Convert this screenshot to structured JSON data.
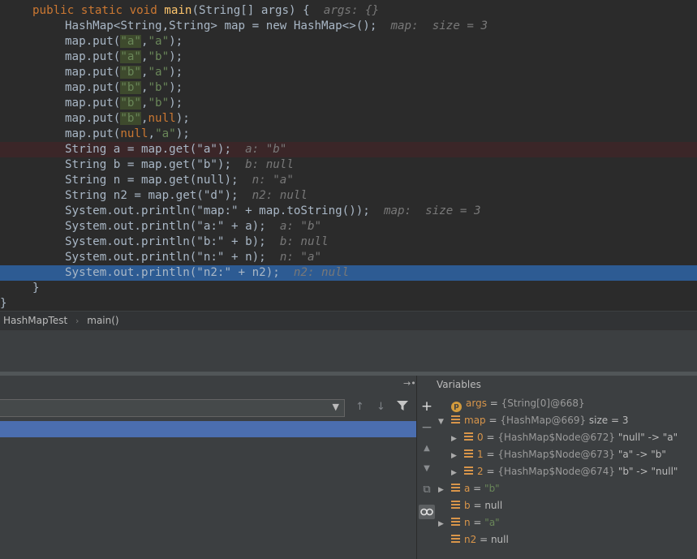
{
  "editor": {
    "method_sig": {
      "pre": "public static void ",
      "name": "main",
      "params": "(String[] args) ",
      "brace": "{",
      "hint": "args: {}"
    },
    "lines": [
      {
        "code": "HashMap<String,String> map = new HashMap<>();",
        "hint": "map:  size = 3"
      },
      {
        "call": "map.put(",
        "a1": "\"a\"",
        "a2": "\"a\""
      },
      {
        "call": "map.put(",
        "a1": "\"a\"",
        "a2": "\"b\""
      },
      {
        "call": "map.put(",
        "a1": "\"b\"",
        "a2": "\"a\""
      },
      {
        "call": "map.put(",
        "a1": "\"b\"",
        "a2": "\"b\""
      },
      {
        "call": "map.put(",
        "a1": "\"b\"",
        "a2": "\"b\""
      },
      {
        "call": "map.put(",
        "a1": "\"b\"",
        "a2": "null"
      },
      {
        "call": "map.put(",
        "a1": "null",
        "a2": "\"a\""
      },
      {
        "code": "String a = map.get(\"a\");",
        "hint": "a: \"b\""
      },
      {
        "code": "String b = map.get(\"b\");",
        "hint": "b: null"
      },
      {
        "code": "String n = map.get(null);",
        "hint": "n: \"a\""
      },
      {
        "code": "String n2 = map.get(\"d\");",
        "hint": "n2: null"
      },
      {
        "code": "System.out.println(\"map:\" + map.toString());",
        "hint": "map:  size = 3"
      },
      {
        "code": "System.out.println(\"a:\" + a);",
        "hint": "a: \"b\""
      },
      {
        "code": "System.out.println(\"b:\" + b);",
        "hint": "b: null"
      },
      {
        "code": "System.out.println(\"n:\" + n);",
        "hint": "n: \"a\""
      },
      {
        "code": "System.out.println(\"n2:\" + n2);",
        "hint": "n2: null"
      }
    ],
    "close_inner": "}",
    "close_outer": "}"
  },
  "breadcrumb": {
    "class_name": "HashMapTest",
    "separator": "›",
    "method_name": "main()"
  },
  "debugger": {
    "restore_icon": "→•",
    "variables_title": "Variables",
    "variables": [
      {
        "arrow": "",
        "kind": "param",
        "name": "args",
        "eq": " = ",
        "value": "{String[0]@668}",
        "extra": ""
      },
      {
        "arrow": "▼",
        "kind": "field",
        "name": "map",
        "eq": " = ",
        "value": "{HashMap@669}",
        "extra": "  size = 3"
      },
      {
        "arrow": "▶",
        "kind": "field",
        "name": "0",
        "eq": " = ",
        "value": "{HashMap$Node@672}",
        "extra": " \"null\" -> \"a\""
      },
      {
        "arrow": "▶",
        "kind": "field",
        "name": "1",
        "eq": " = ",
        "value": "{HashMap$Node@673}",
        "extra": " \"a\" -> \"b\""
      },
      {
        "arrow": "▶",
        "kind": "field",
        "name": "2",
        "eq": " = ",
        "value": "{HashMap$Node@674}",
        "extra": " \"b\" -> \"null\""
      },
      {
        "arrow": "▶",
        "kind": "field",
        "name": "a",
        "eq": " = ",
        "value": "\"b\"",
        "extra": ""
      },
      {
        "arrow": "",
        "kind": "field",
        "name": "b",
        "eq": " = ",
        "value": "null",
        "extra": ""
      },
      {
        "arrow": "▶",
        "kind": "field",
        "name": "n",
        "eq": " = ",
        "value": "\"a\"",
        "extra": ""
      },
      {
        "arrow": "",
        "kind": "field",
        "name": "n2",
        "eq": " = ",
        "value": "null",
        "extra": ""
      }
    ],
    "param_badge": "p"
  },
  "colors": {
    "editor_bg": "#2b2b2b",
    "keyword": "#cc7832",
    "string": "#6a8759",
    "current_line": "#2d5b93",
    "selected_frame": "#4b6eaf"
  }
}
